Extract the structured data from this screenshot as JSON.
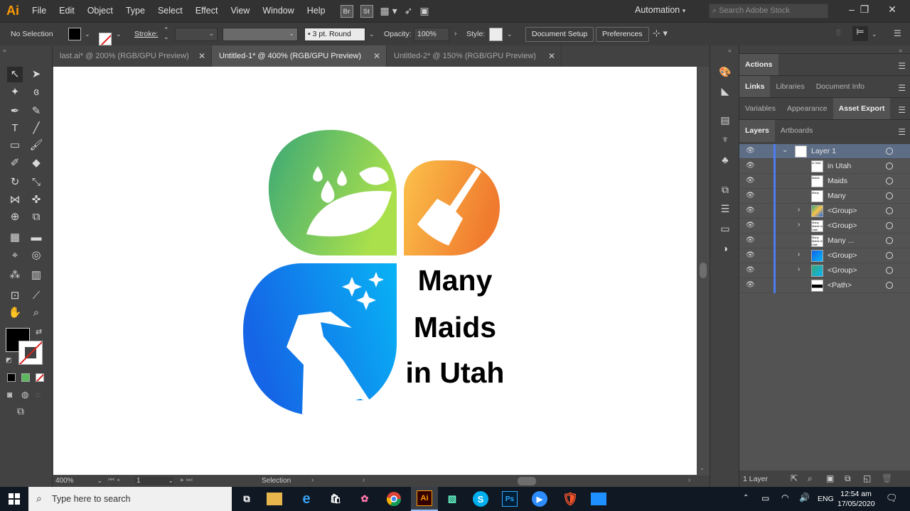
{
  "app": {
    "logo": "Ai"
  },
  "menu": [
    "File",
    "Edit",
    "Object",
    "Type",
    "Select",
    "Effect",
    "View",
    "Window",
    "Help"
  ],
  "menu_icons": [
    "Br",
    "St"
  ],
  "workspace": "Automation",
  "search": {
    "placeholder": "Search Adobe Stock"
  },
  "control": {
    "selection": "No Selection",
    "stroke_label": "Stroke:",
    "brush": "3 pt. Round",
    "opacity_label": "Opacity:",
    "opacity_value": "100%",
    "style_label": "Style:",
    "doc_setup": "Document Setup",
    "preferences": "Preferences"
  },
  "tabs": [
    {
      "label": "last.ai* @ 200% (RGB/GPU Preview)",
      "active": false
    },
    {
      "label": "Untitled-1* @ 400% (RGB/GPU Preview)",
      "active": true
    },
    {
      "label": "Untitled-2* @ 150% (RGB/GPU Preview)",
      "active": false
    }
  ],
  "artwork": {
    "line1": "Many",
    "line2": "Maids",
    "line3": "in Utah",
    "colors": {
      "green_a": "#3aa876",
      "green_b": "#a9e04c",
      "orange_a": "#fbc24a",
      "orange_b": "#f07a2e",
      "blue_a": "#1565e6",
      "blue_b": "#08b3f5"
    }
  },
  "status": {
    "zoom": "400%",
    "artboard": "1",
    "tool": "Selection"
  },
  "panels": {
    "row1": [
      "Actions"
    ],
    "row2": [
      "Links",
      "Libraries",
      "Document Info"
    ],
    "row3": [
      "Variables",
      "Appearance",
      "Asset Export"
    ],
    "row4": [
      "Layers",
      "Artboards"
    ]
  },
  "layers": [
    {
      "name": "Layer 1",
      "thumb_text": ""
    },
    {
      "name": "in Utah",
      "thumb_text": "in Utah"
    },
    {
      "name": "Maids",
      "thumb_text": "Maids"
    },
    {
      "name": "Many",
      "thumb_text": "Many"
    },
    {
      "name": "<Group>",
      "thumb_text": ""
    },
    {
      "name": "<Group>",
      "thumb_text": "Many Maids in Utah"
    },
    {
      "name": "Many  ...",
      "thumb_text": "Many Maids in Utah"
    },
    {
      "name": "<Group>",
      "thumb_text": ""
    },
    {
      "name": "<Group>",
      "thumb_text": ""
    },
    {
      "name": "<Path>",
      "thumb_text": ""
    }
  ],
  "layers_count": "1 Layer",
  "taskbar": {
    "search": "Type here to search",
    "apps": [
      "Ai",
      "Ps",
      "S"
    ],
    "lang": "ENG",
    "time": "12:54 am",
    "date": "17/05/2020"
  }
}
